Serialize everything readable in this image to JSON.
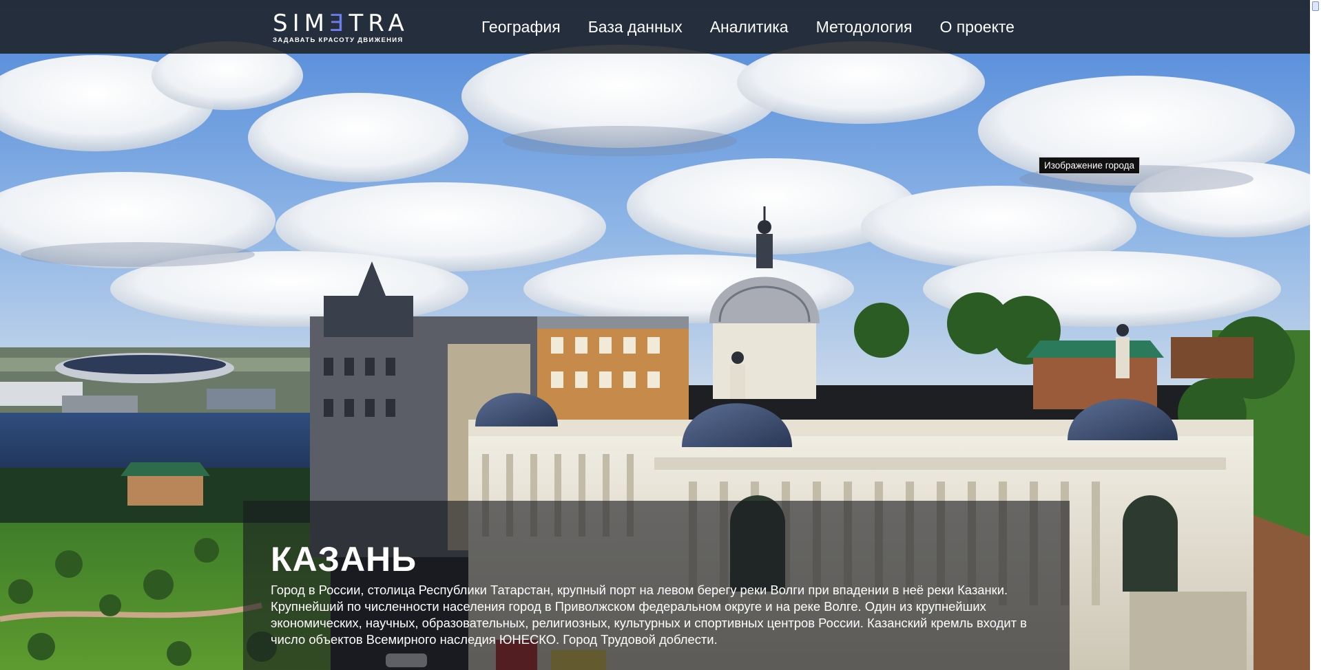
{
  "header": {
    "logo_text_pre": "SIM",
    "logo_text_accent": "Ǝ",
    "logo_text_post": "TRA",
    "logo_tagline": "ЗАДАВАТЬ КРАСОТУ ДВИЖЕНИЯ",
    "menu": [
      {
        "label": "География"
      },
      {
        "label": "База данных"
      },
      {
        "label": "Аналитика"
      },
      {
        "label": "Методология"
      },
      {
        "label": "О проекте"
      }
    ]
  },
  "hero": {
    "image_tooltip": "Изображение города"
  },
  "city": {
    "name": "КАЗАНЬ",
    "description": "Город в России, столица Республики Татарстан, крупный порт на левом берегу реки Волги при впадении в неё реки Казанки. Крупнейший по численности населения город в Приволжском федеральном округе и на реке Волге. Один из крупнейших экономических, научных, образовательных, религиозных, культурных и спортивных центров России. Казанский кремль входит в число объектов Всемирного наследия ЮНЕСКО. Город Трудовой доблести."
  },
  "colors": {
    "nav_bg": "#1e2126",
    "logo_accent": "#6d7ff0",
    "sky": "#5a8fd6",
    "river": "#2d4a7a",
    "palace": "#e8e4d6",
    "dome": "#3a4b6c"
  }
}
